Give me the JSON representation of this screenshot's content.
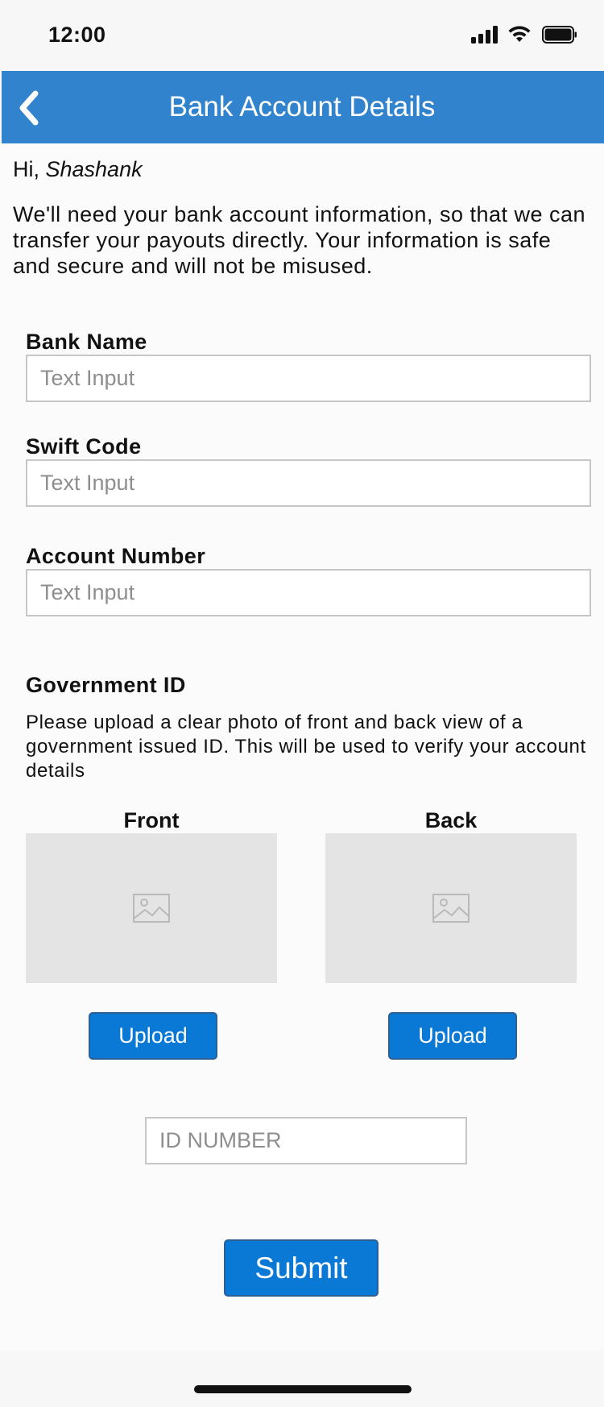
{
  "status_bar": {
    "time": "12:00"
  },
  "nav": {
    "title": "Bank Account Details",
    "back_icon": "chevron-left-icon"
  },
  "greeting": {
    "prefix": "Hi, ",
    "name": "Shashank"
  },
  "intro_text": "We'll need your bank account information, so that we can transfer your payouts directly. Your information is safe and secure and will not be misused.",
  "fields": {
    "bank_name": {
      "label": "Bank Name",
      "placeholder": "Text Input",
      "value": ""
    },
    "swift_code": {
      "label": "Swift Code",
      "placeholder": "Text Input",
      "value": ""
    },
    "account_number": {
      "label": "Account Number",
      "placeholder": "Text Input",
      "value": ""
    }
  },
  "government_id": {
    "title": "Government ID",
    "description": "Please upload a clear photo of front and back view of a government issued ID. This will be used to verify your account details",
    "front": {
      "label": "Front",
      "upload_label": "Upload",
      "icon": "image-placeholder-icon"
    },
    "back": {
      "label": "Back",
      "upload_label": "Upload",
      "icon": "image-placeholder-icon"
    },
    "id_number": {
      "placeholder": "ID NUMBER",
      "value": ""
    }
  },
  "submit_label": "Submit",
  "colors": {
    "nav_background": "#3183cd",
    "button_background": "#0a79d6",
    "placeholder_box": "#e4e4e4"
  }
}
